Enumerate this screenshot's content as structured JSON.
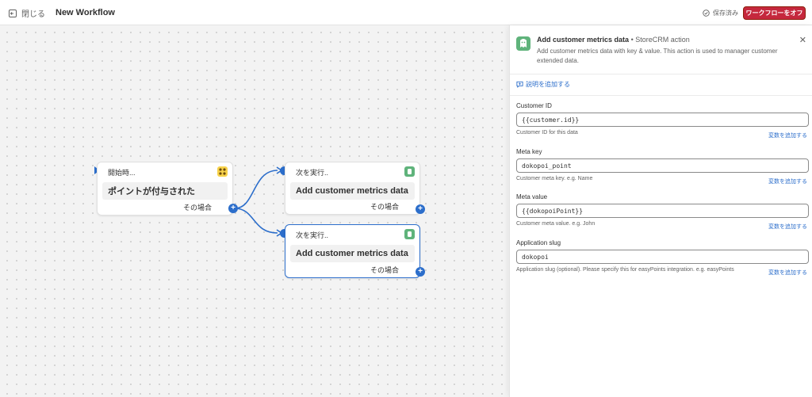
{
  "topbar": {
    "close_label": "閉じる",
    "workflow_title": "New Workflow",
    "saved_label": "保存済み",
    "toggle_label": "ワークフローをオフ"
  },
  "nodes": {
    "trigger": {
      "head": "開始時...",
      "body": "ポイントが付与された",
      "foot": "その場合"
    },
    "action1": {
      "head": "次を実行..",
      "body": "Add customer metrics data",
      "foot": "その場合"
    },
    "action2": {
      "head": "次を実行..",
      "body": "Add customer metrics data",
      "foot": "その場合"
    }
  },
  "panel": {
    "title": "Add customer metrics data",
    "separator": "•",
    "subtitle": "StoreCRM action",
    "description": "Add customer metrics data with key & value. This action is used to manager customer extended data.",
    "add_description": "説明を追加する",
    "fields": [
      {
        "label": "Customer ID",
        "value": "{{customer.id}}",
        "help": "Customer ID for this data",
        "var_link": "変数を追加する"
      },
      {
        "label": "Meta key",
        "value": "dokopoi_point",
        "help": "Customer meta key. e.g. Name",
        "var_link": "変数を追加する"
      },
      {
        "label": "Meta value",
        "value": "{{dokopoiPoint}}",
        "help": "Customer meta value. e.g. John",
        "var_link": "変数を追加する"
      },
      {
        "label": "Application slug",
        "value": "dokopoi",
        "help": "Application slug (optional). Please specify this for easyPoints integration. e.g. easyPoints",
        "var_link": "変数を追加する"
      }
    ]
  },
  "colors": {
    "accent": "#2c6ecb",
    "danger": "#c5283d",
    "app_green": "#5fb37b"
  },
  "icons": [
    "exit-icon",
    "check-circle-icon",
    "trigger-app-icon",
    "storecrm-icon",
    "close-icon",
    "comment-plus-icon",
    "plus-icon"
  ]
}
